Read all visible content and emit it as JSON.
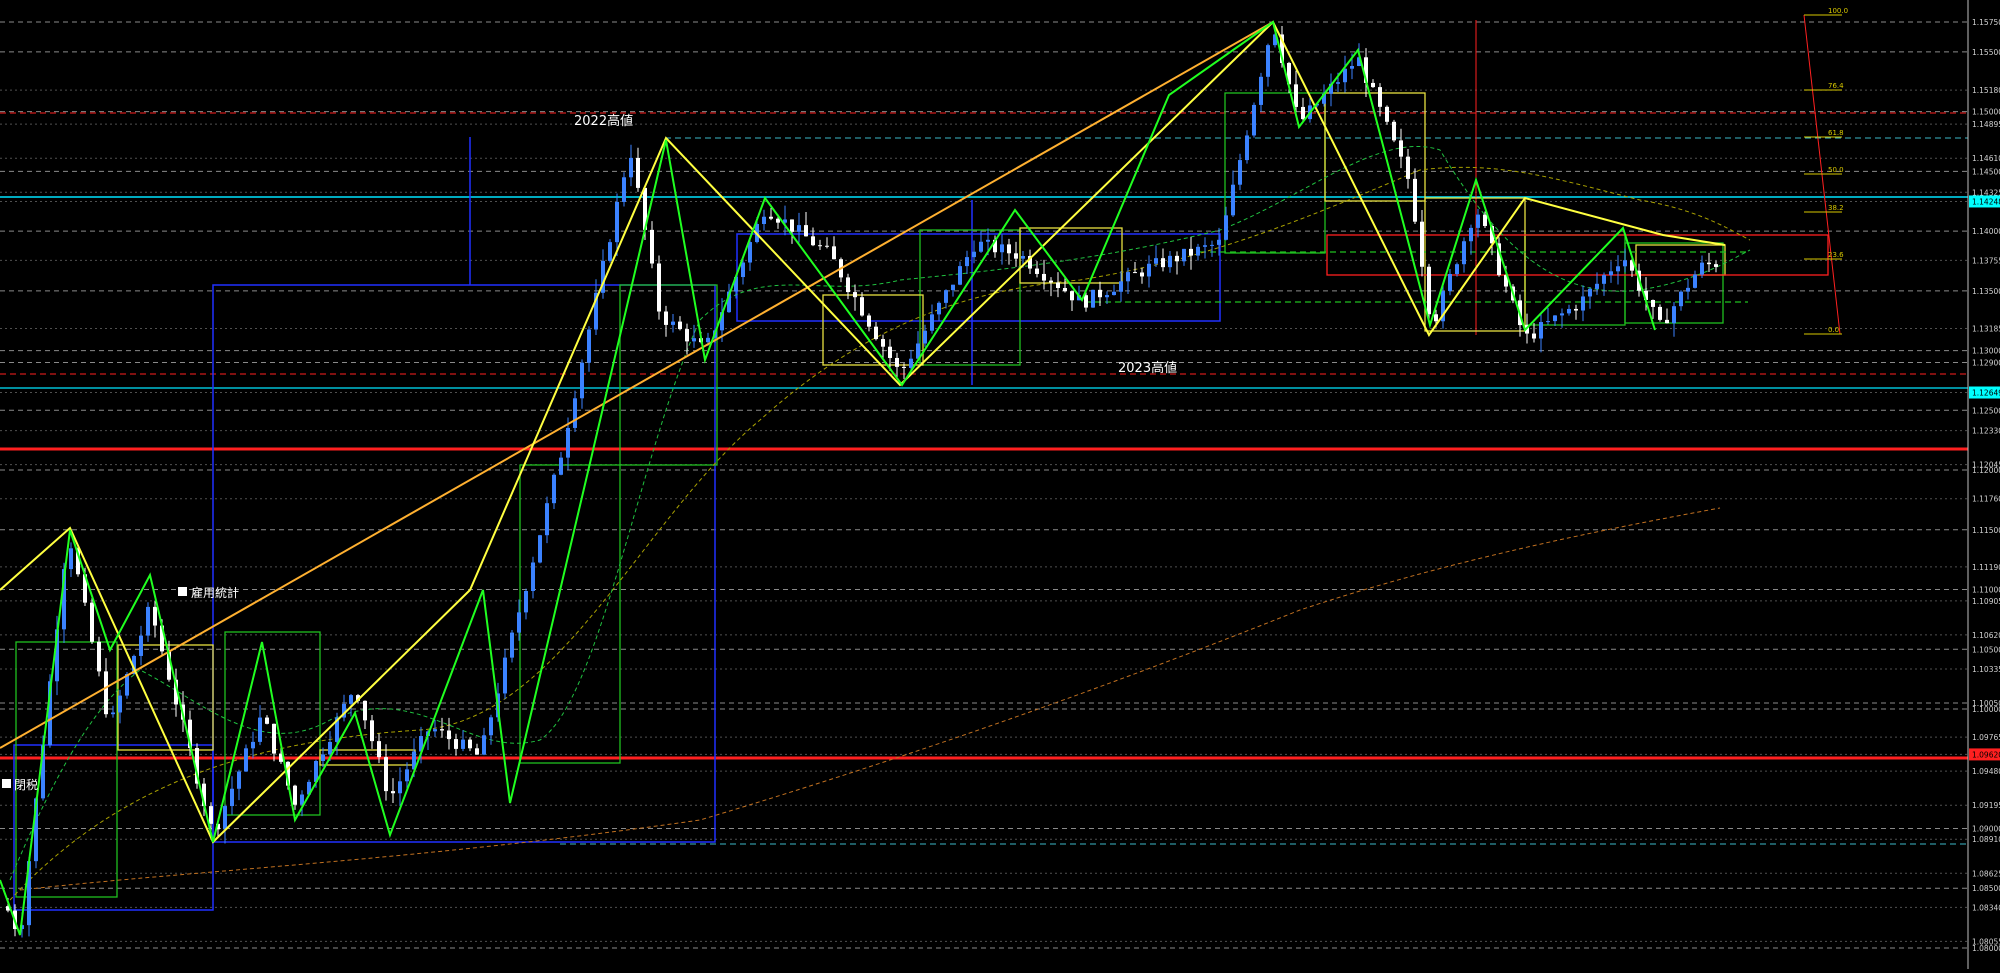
{
  "chart_data": {
    "type": "candlestick",
    "instrument_hint": "",
    "annotations": {
      "high_2022": "2022高値",
      "high_2023": "2023高値",
      "employment_stats": "雇用統計",
      "close_label": "閉税"
    },
    "y_axis": {
      "ticks": [
        "1.15750",
        "1.15500",
        "1.15180",
        "1.15000",
        "1.14895",
        "1.14610",
        "1.14500",
        "1.14325",
        "1.14248",
        "1.14000",
        "1.13755",
        "1.13500",
        "1.13185",
        "1.13000",
        "1.12900",
        "1.12649",
        "1.12500",
        "1.12330",
        "1.12045",
        "1.12000",
        "1.11760",
        "1.11500",
        "1.11190",
        "1.11000",
        "1.10905",
        "1.10620",
        "1.10500",
        "1.10335",
        "1.10050",
        "1.10000",
        "1.09765",
        "1.09620",
        "1.09480",
        "1.09195",
        "1.09000",
        "1.08910",
        "1.08625",
        "1.08500",
        "1.08340",
        "1.08055",
        "1.08000"
      ],
      "highlighted": [
        {
          "label": "1.14248",
          "color": "#00ffff"
        },
        {
          "label": "1.12649",
          "color": "#00ffff"
        },
        {
          "label": "1.09620",
          "color": "#ff2020"
        }
      ]
    },
    "fibonacci": {
      "levels": [
        "100.0",
        "76.4",
        "61.8",
        "50.0",
        "38.2",
        "23.6",
        "0.0"
      ],
      "color": "#d8c800"
    },
    "colors": {
      "background": "#000000",
      "grid": "#c0c0c0",
      "zigzag_primary": "#20ff20",
      "zigzag_secondary": "#ffff40",
      "trendline": "#ffb030",
      "support_resistance": "#ff2020",
      "key_level": "#00ffff",
      "range_box": "#2030ff",
      "bull_candle": "#3b82ff",
      "bear_candle": "#ffffff"
    }
  }
}
